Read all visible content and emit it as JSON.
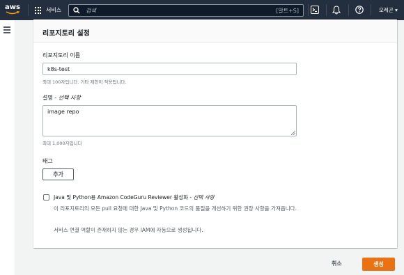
{
  "topnav": {
    "logo_text": "aws",
    "services_label": "서비스",
    "search_placeholder": "검색",
    "search_shortcut": "[알트+S]",
    "region": "오레곤 ▾",
    "icons": [
      "cloudshell-icon",
      "bell-icon",
      "help-icon"
    ]
  },
  "panel": {
    "title": "리포지토리 설정",
    "name_label": "리포지토리 이름",
    "name_value": "k8s-test",
    "name_hint": "최대 100자입니다. 기타 제한이 적용됩니다.",
    "desc_label": "설명 - ",
    "desc_label_optional": "선택 사항",
    "desc_value": "image repo",
    "desc_hint": "최대 1,000자입니다",
    "tags_label": "태그",
    "add_button": "추가",
    "codeguru_label": "Java 및 Python용 Amazon CodeGuru Reviewer 활성화 - ",
    "codeguru_label_optional": "선택 사항",
    "codeguru_desc": "이 리포지토리의 모든 pull 요청에 대한 Java 및 Python 코드의 품질을 개선하기 위한 권장 사항을 가져옵니다.",
    "codeguru_note": "서비스 연결 역할이 존재하지 않는 경우 IAM에 자동으로 생성됩니다."
  },
  "footer": {
    "cancel": "취소",
    "create": "생성"
  },
  "colors": {
    "nav_bg": "#232f3e",
    "primary": "#ec7211",
    "logo_smile": "#ff9900"
  }
}
